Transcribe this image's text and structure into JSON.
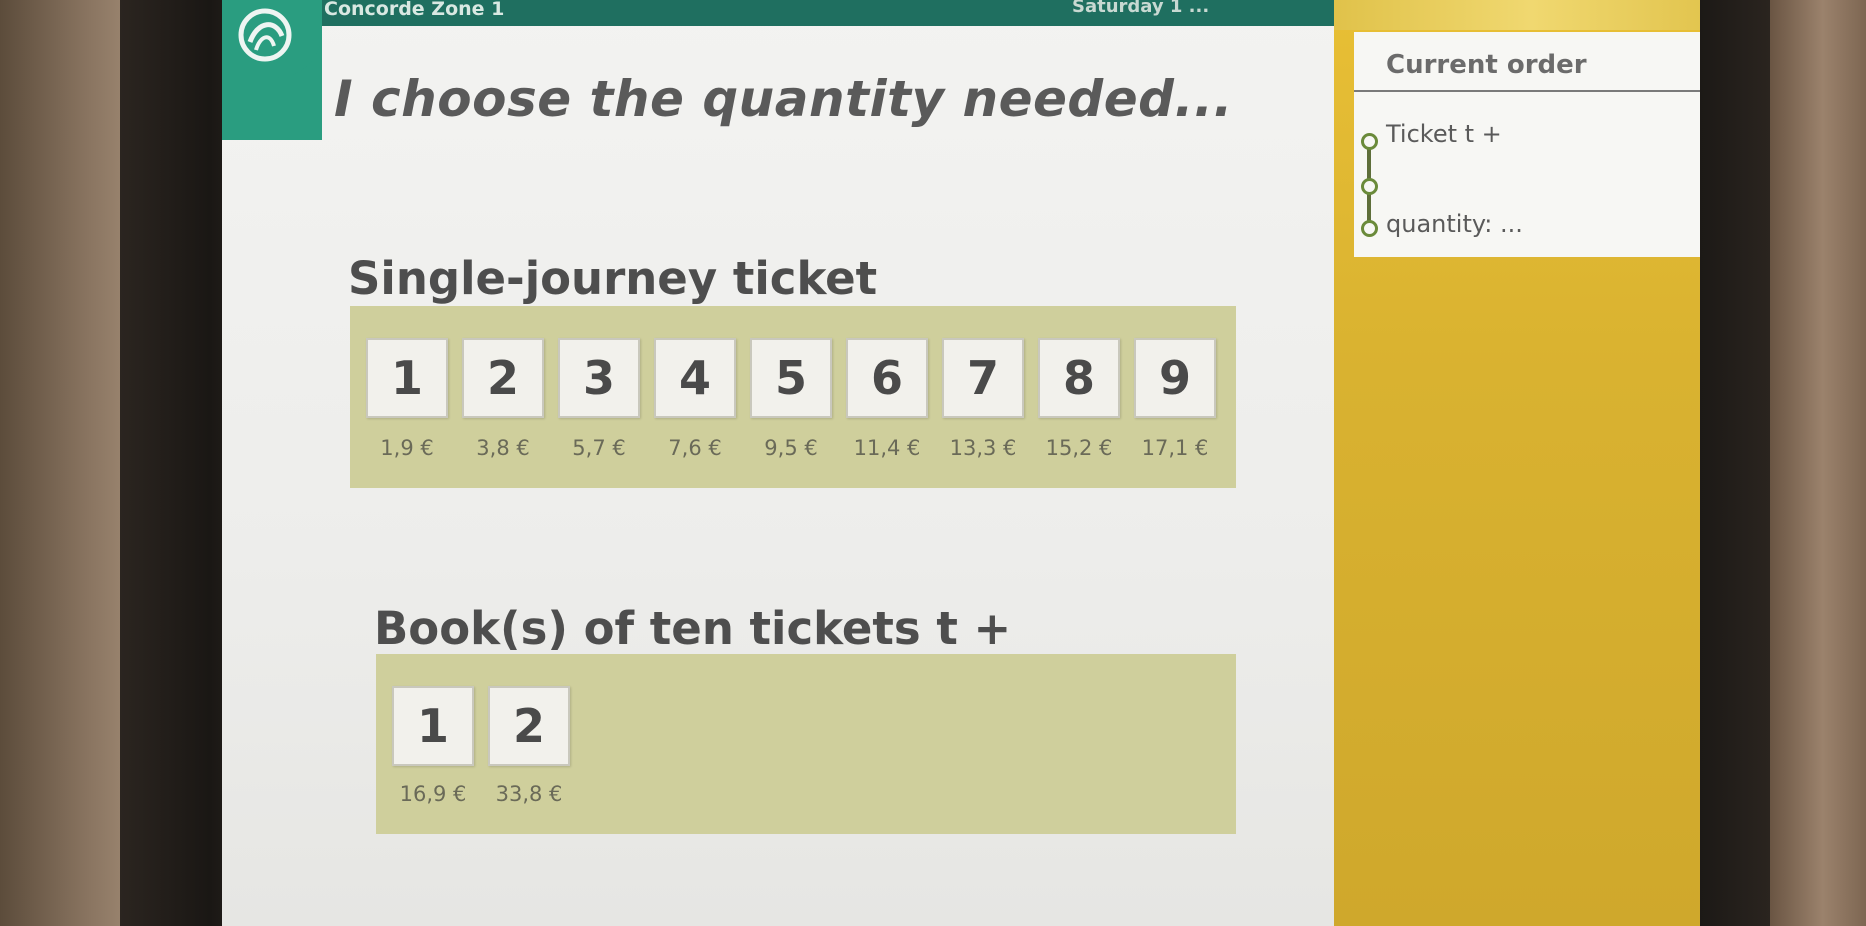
{
  "header": {
    "station": "Concorde Zone 1",
    "date": "Saturday 1 ..."
  },
  "heading": "I choose the quantity needed...",
  "single": {
    "title": "Single-journey ticket",
    "options": [
      {
        "qty": "1",
        "price": "1,9 €"
      },
      {
        "qty": "2",
        "price": "3,8 €"
      },
      {
        "qty": "3",
        "price": "5,7 €"
      },
      {
        "qty": "4",
        "price": "7,6 €"
      },
      {
        "qty": "5",
        "price": "9,5 €"
      },
      {
        "qty": "6",
        "price": "11,4 €"
      },
      {
        "qty": "7",
        "price": "13,3 €"
      },
      {
        "qty": "8",
        "price": "15,2 €"
      },
      {
        "qty": "9",
        "price": "17,1 €"
      }
    ]
  },
  "book": {
    "title": "Book(s) of ten tickets t +",
    "options": [
      {
        "qty": "1",
        "price": "16,9 €"
      },
      {
        "qty": "2",
        "price": "33,8 €"
      }
    ]
  },
  "order": {
    "title": "Current order",
    "item": "Ticket t +",
    "quantity": "quantity: ..."
  },
  "colors": {
    "panel": "#cfcf9c",
    "sidebar": "#d9b230",
    "brand_teal": "#2a9d80"
  },
  "icons": {
    "logo": "ratp-logo-icon"
  }
}
